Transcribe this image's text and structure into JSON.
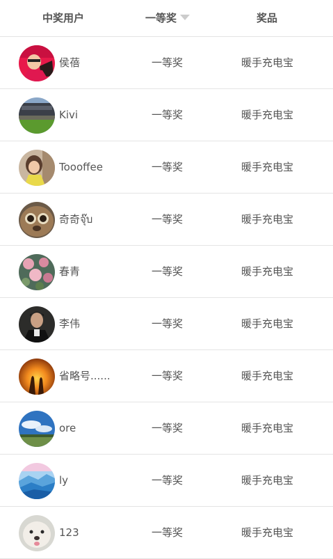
{
  "header": {
    "user_label": "中奖用户",
    "prize_label": "一等奖",
    "award_label": "奖品"
  },
  "rows": [
    {
      "user": "侯蓓",
      "prize": "一等奖",
      "award": "暖手充电宝",
      "avatar": "red-hat-avatar"
    },
    {
      "user": "Kivi",
      "prize": "一等奖",
      "award": "暖手充电宝",
      "avatar": "building-lawn-avatar"
    },
    {
      "user": "Toooffee",
      "prize": "一等奖",
      "award": "暖手充电宝",
      "avatar": "child-avatar"
    },
    {
      "user": "奇奇จุ๊บ",
      "prize": "一等奖",
      "award": "暖手充电宝",
      "avatar": "plush-toy-avatar"
    },
    {
      "user": "春青",
      "prize": "一等奖",
      "award": "暖手充电宝",
      "avatar": "flowers-avatar"
    },
    {
      "user": "李伟",
      "prize": "一等奖",
      "award": "暖手充电宝",
      "avatar": "portrait-avatar"
    },
    {
      "user": "省略号......",
      "prize": "一等奖",
      "award": "暖手充电宝",
      "avatar": "sunset-avatar"
    },
    {
      "user": "ore",
      "prize": "一等奖",
      "award": "暖手充电宝",
      "avatar": "sky-landscape-avatar"
    },
    {
      "user": "ly",
      "prize": "一等奖",
      "award": "暖手充电宝",
      "avatar": "blue-mountains-avatar"
    },
    {
      "user": "123",
      "prize": "一等奖",
      "award": "暖手充电宝",
      "avatar": "puppy-avatar"
    }
  ]
}
